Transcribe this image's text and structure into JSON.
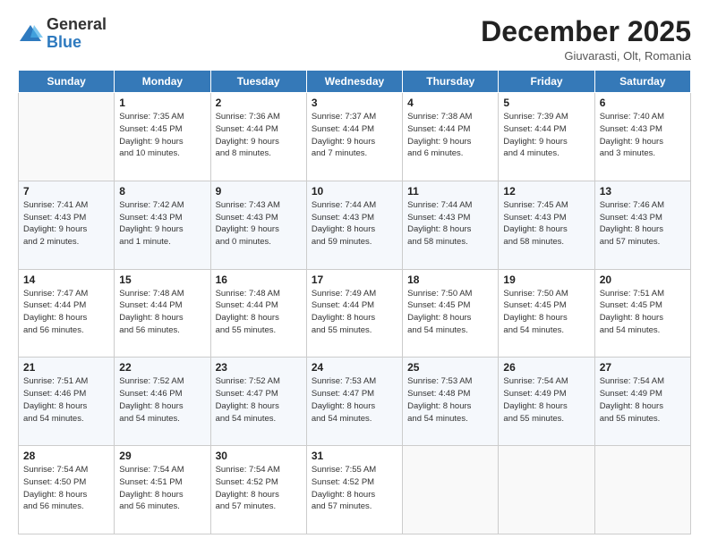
{
  "logo": {
    "general": "General",
    "blue": "Blue"
  },
  "header": {
    "month_year": "December 2025",
    "location": "Giuvarasti, Olt, Romania"
  },
  "days_of_week": [
    "Sunday",
    "Monday",
    "Tuesday",
    "Wednesday",
    "Thursday",
    "Friday",
    "Saturday"
  ],
  "weeks": [
    [
      {
        "day": "",
        "info": ""
      },
      {
        "day": "1",
        "info": "Sunrise: 7:35 AM\nSunset: 4:45 PM\nDaylight: 9 hours\nand 10 minutes."
      },
      {
        "day": "2",
        "info": "Sunrise: 7:36 AM\nSunset: 4:44 PM\nDaylight: 9 hours\nand 8 minutes."
      },
      {
        "day": "3",
        "info": "Sunrise: 7:37 AM\nSunset: 4:44 PM\nDaylight: 9 hours\nand 7 minutes."
      },
      {
        "day": "4",
        "info": "Sunrise: 7:38 AM\nSunset: 4:44 PM\nDaylight: 9 hours\nand 6 minutes."
      },
      {
        "day": "5",
        "info": "Sunrise: 7:39 AM\nSunset: 4:44 PM\nDaylight: 9 hours\nand 4 minutes."
      },
      {
        "day": "6",
        "info": "Sunrise: 7:40 AM\nSunset: 4:43 PM\nDaylight: 9 hours\nand 3 minutes."
      }
    ],
    [
      {
        "day": "7",
        "info": "Sunrise: 7:41 AM\nSunset: 4:43 PM\nDaylight: 9 hours\nand 2 minutes."
      },
      {
        "day": "8",
        "info": "Sunrise: 7:42 AM\nSunset: 4:43 PM\nDaylight: 9 hours\nand 1 minute."
      },
      {
        "day": "9",
        "info": "Sunrise: 7:43 AM\nSunset: 4:43 PM\nDaylight: 9 hours\nand 0 minutes."
      },
      {
        "day": "10",
        "info": "Sunrise: 7:44 AM\nSunset: 4:43 PM\nDaylight: 8 hours\nand 59 minutes."
      },
      {
        "day": "11",
        "info": "Sunrise: 7:44 AM\nSunset: 4:43 PM\nDaylight: 8 hours\nand 58 minutes."
      },
      {
        "day": "12",
        "info": "Sunrise: 7:45 AM\nSunset: 4:43 PM\nDaylight: 8 hours\nand 58 minutes."
      },
      {
        "day": "13",
        "info": "Sunrise: 7:46 AM\nSunset: 4:43 PM\nDaylight: 8 hours\nand 57 minutes."
      }
    ],
    [
      {
        "day": "14",
        "info": "Sunrise: 7:47 AM\nSunset: 4:44 PM\nDaylight: 8 hours\nand 56 minutes."
      },
      {
        "day": "15",
        "info": "Sunrise: 7:48 AM\nSunset: 4:44 PM\nDaylight: 8 hours\nand 56 minutes."
      },
      {
        "day": "16",
        "info": "Sunrise: 7:48 AM\nSunset: 4:44 PM\nDaylight: 8 hours\nand 55 minutes."
      },
      {
        "day": "17",
        "info": "Sunrise: 7:49 AM\nSunset: 4:44 PM\nDaylight: 8 hours\nand 55 minutes."
      },
      {
        "day": "18",
        "info": "Sunrise: 7:50 AM\nSunset: 4:45 PM\nDaylight: 8 hours\nand 54 minutes."
      },
      {
        "day": "19",
        "info": "Sunrise: 7:50 AM\nSunset: 4:45 PM\nDaylight: 8 hours\nand 54 minutes."
      },
      {
        "day": "20",
        "info": "Sunrise: 7:51 AM\nSunset: 4:45 PM\nDaylight: 8 hours\nand 54 minutes."
      }
    ],
    [
      {
        "day": "21",
        "info": "Sunrise: 7:51 AM\nSunset: 4:46 PM\nDaylight: 8 hours\nand 54 minutes."
      },
      {
        "day": "22",
        "info": "Sunrise: 7:52 AM\nSunset: 4:46 PM\nDaylight: 8 hours\nand 54 minutes."
      },
      {
        "day": "23",
        "info": "Sunrise: 7:52 AM\nSunset: 4:47 PM\nDaylight: 8 hours\nand 54 minutes."
      },
      {
        "day": "24",
        "info": "Sunrise: 7:53 AM\nSunset: 4:47 PM\nDaylight: 8 hours\nand 54 minutes."
      },
      {
        "day": "25",
        "info": "Sunrise: 7:53 AM\nSunset: 4:48 PM\nDaylight: 8 hours\nand 54 minutes."
      },
      {
        "day": "26",
        "info": "Sunrise: 7:54 AM\nSunset: 4:49 PM\nDaylight: 8 hours\nand 55 minutes."
      },
      {
        "day": "27",
        "info": "Sunrise: 7:54 AM\nSunset: 4:49 PM\nDaylight: 8 hours\nand 55 minutes."
      }
    ],
    [
      {
        "day": "28",
        "info": "Sunrise: 7:54 AM\nSunset: 4:50 PM\nDaylight: 8 hours\nand 56 minutes."
      },
      {
        "day": "29",
        "info": "Sunrise: 7:54 AM\nSunset: 4:51 PM\nDaylight: 8 hours\nand 56 minutes."
      },
      {
        "day": "30",
        "info": "Sunrise: 7:54 AM\nSunset: 4:52 PM\nDaylight: 8 hours\nand 57 minutes."
      },
      {
        "day": "31",
        "info": "Sunrise: 7:55 AM\nSunset: 4:52 PM\nDaylight: 8 hours\nand 57 minutes."
      },
      {
        "day": "",
        "info": ""
      },
      {
        "day": "",
        "info": ""
      },
      {
        "day": "",
        "info": ""
      }
    ]
  ]
}
